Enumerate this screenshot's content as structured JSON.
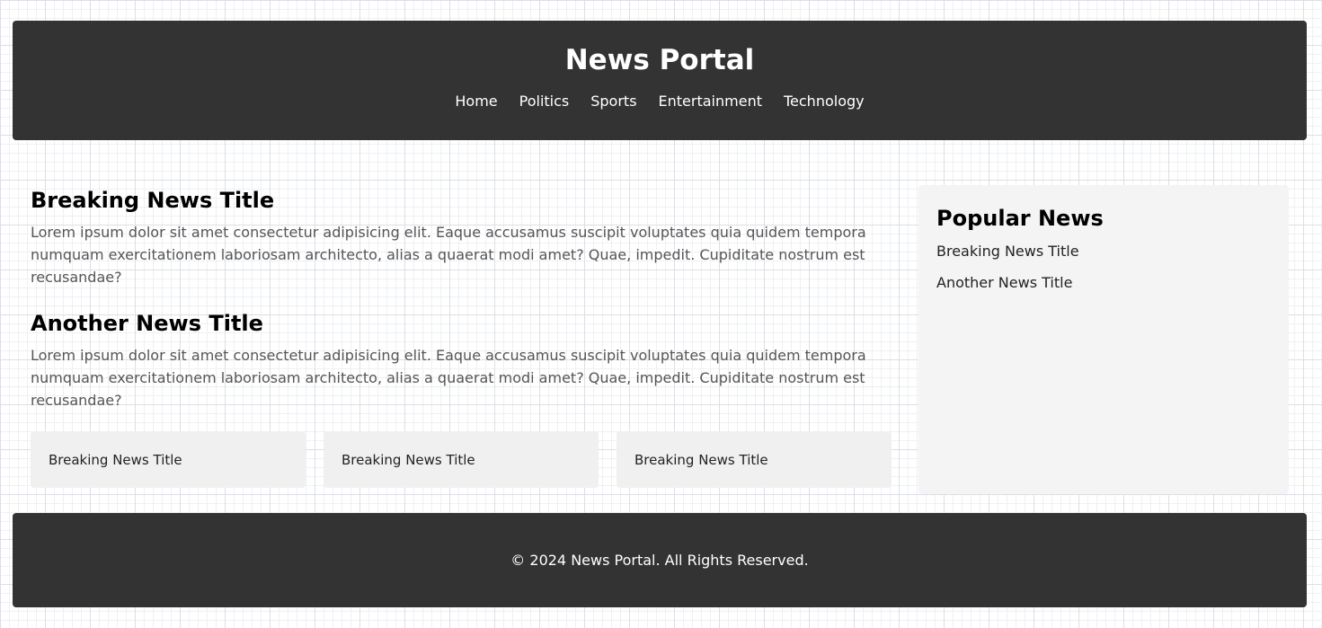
{
  "header": {
    "title": "News Portal",
    "nav": [
      "Home",
      "Politics",
      "Sports",
      "Entertainment",
      "Technology"
    ]
  },
  "main": {
    "articles": [
      {
        "title": "Breaking News Title",
        "body": "Lorem ipsum dolor sit amet consectetur adipisicing elit. Eaque accusamus suscipit voluptates quia quidem tempora numquam exercitationem laboriosam architecto, alias a quaerat modi amet? Quae, impedit. Cupiditate nostrum est recusandae?"
      },
      {
        "title": "Another News Title",
        "body": "Lorem ipsum dolor sit amet consectetur adipisicing elit. Eaque accusamus suscipit voluptates quia quidem tempora numquam exercitationem laboriosam architecto, alias a quaerat modi amet? Quae, impedit. Cupiditate nostrum est recusandae?"
      }
    ],
    "cards": [
      "Breaking News Title",
      "Breaking News Title",
      "Breaking News Title"
    ]
  },
  "sidebar": {
    "title": "Popular News",
    "items": [
      "Breaking News Title",
      "Another News Title"
    ]
  },
  "footer": {
    "text": "© 2024 News Portal. All Rights Reserved."
  },
  "colors": {
    "header_bg": "#333333",
    "footer_bg": "#333333",
    "sidebar_bg": "#f4f4f4",
    "card_bg": "#f0f0f0"
  }
}
